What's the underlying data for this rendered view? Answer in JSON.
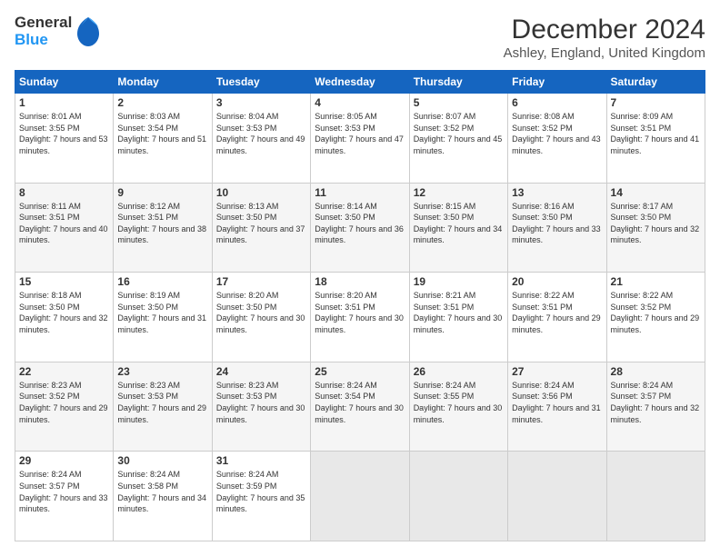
{
  "logo": {
    "line1": "General",
    "line2": "Blue"
  },
  "title": "December 2024",
  "subtitle": "Ashley, England, United Kingdom",
  "headers": [
    "Sunday",
    "Monday",
    "Tuesday",
    "Wednesday",
    "Thursday",
    "Friday",
    "Saturday"
  ],
  "weeks": [
    [
      {
        "day": "1",
        "sunrise": "Sunrise: 8:01 AM",
        "sunset": "Sunset: 3:55 PM",
        "daylight": "Daylight: 7 hours and 53 minutes."
      },
      {
        "day": "2",
        "sunrise": "Sunrise: 8:03 AM",
        "sunset": "Sunset: 3:54 PM",
        "daylight": "Daylight: 7 hours and 51 minutes."
      },
      {
        "day": "3",
        "sunrise": "Sunrise: 8:04 AM",
        "sunset": "Sunset: 3:53 PM",
        "daylight": "Daylight: 7 hours and 49 minutes."
      },
      {
        "day": "4",
        "sunrise": "Sunrise: 8:05 AM",
        "sunset": "Sunset: 3:53 PM",
        "daylight": "Daylight: 7 hours and 47 minutes."
      },
      {
        "day": "5",
        "sunrise": "Sunrise: 8:07 AM",
        "sunset": "Sunset: 3:52 PM",
        "daylight": "Daylight: 7 hours and 45 minutes."
      },
      {
        "day": "6",
        "sunrise": "Sunrise: 8:08 AM",
        "sunset": "Sunset: 3:52 PM",
        "daylight": "Daylight: 7 hours and 43 minutes."
      },
      {
        "day": "7",
        "sunrise": "Sunrise: 8:09 AM",
        "sunset": "Sunset: 3:51 PM",
        "daylight": "Daylight: 7 hours and 41 minutes."
      }
    ],
    [
      {
        "day": "8",
        "sunrise": "Sunrise: 8:11 AM",
        "sunset": "Sunset: 3:51 PM",
        "daylight": "Daylight: 7 hours and 40 minutes."
      },
      {
        "day": "9",
        "sunrise": "Sunrise: 8:12 AM",
        "sunset": "Sunset: 3:51 PM",
        "daylight": "Daylight: 7 hours and 38 minutes."
      },
      {
        "day": "10",
        "sunrise": "Sunrise: 8:13 AM",
        "sunset": "Sunset: 3:50 PM",
        "daylight": "Daylight: 7 hours and 37 minutes."
      },
      {
        "day": "11",
        "sunrise": "Sunrise: 8:14 AM",
        "sunset": "Sunset: 3:50 PM",
        "daylight": "Daylight: 7 hours and 36 minutes."
      },
      {
        "day": "12",
        "sunrise": "Sunrise: 8:15 AM",
        "sunset": "Sunset: 3:50 PM",
        "daylight": "Daylight: 7 hours and 34 minutes."
      },
      {
        "day": "13",
        "sunrise": "Sunrise: 8:16 AM",
        "sunset": "Sunset: 3:50 PM",
        "daylight": "Daylight: 7 hours and 33 minutes."
      },
      {
        "day": "14",
        "sunrise": "Sunrise: 8:17 AM",
        "sunset": "Sunset: 3:50 PM",
        "daylight": "Daylight: 7 hours and 32 minutes."
      }
    ],
    [
      {
        "day": "15",
        "sunrise": "Sunrise: 8:18 AM",
        "sunset": "Sunset: 3:50 PM",
        "daylight": "Daylight: 7 hours and 32 minutes."
      },
      {
        "day": "16",
        "sunrise": "Sunrise: 8:19 AM",
        "sunset": "Sunset: 3:50 PM",
        "daylight": "Daylight: 7 hours and 31 minutes."
      },
      {
        "day": "17",
        "sunrise": "Sunrise: 8:20 AM",
        "sunset": "Sunset: 3:50 PM",
        "daylight": "Daylight: 7 hours and 30 minutes."
      },
      {
        "day": "18",
        "sunrise": "Sunrise: 8:20 AM",
        "sunset": "Sunset: 3:51 PM",
        "daylight": "Daylight: 7 hours and 30 minutes."
      },
      {
        "day": "19",
        "sunrise": "Sunrise: 8:21 AM",
        "sunset": "Sunset: 3:51 PM",
        "daylight": "Daylight: 7 hours and 30 minutes."
      },
      {
        "day": "20",
        "sunrise": "Sunrise: 8:22 AM",
        "sunset": "Sunset: 3:51 PM",
        "daylight": "Daylight: 7 hours and 29 minutes."
      },
      {
        "day": "21",
        "sunrise": "Sunrise: 8:22 AM",
        "sunset": "Sunset: 3:52 PM",
        "daylight": "Daylight: 7 hours and 29 minutes."
      }
    ],
    [
      {
        "day": "22",
        "sunrise": "Sunrise: 8:23 AM",
        "sunset": "Sunset: 3:52 PM",
        "daylight": "Daylight: 7 hours and 29 minutes."
      },
      {
        "day": "23",
        "sunrise": "Sunrise: 8:23 AM",
        "sunset": "Sunset: 3:53 PM",
        "daylight": "Daylight: 7 hours and 29 minutes."
      },
      {
        "day": "24",
        "sunrise": "Sunrise: 8:23 AM",
        "sunset": "Sunset: 3:53 PM",
        "daylight": "Daylight: 7 hours and 30 minutes."
      },
      {
        "day": "25",
        "sunrise": "Sunrise: 8:24 AM",
        "sunset": "Sunset: 3:54 PM",
        "daylight": "Daylight: 7 hours and 30 minutes."
      },
      {
        "day": "26",
        "sunrise": "Sunrise: 8:24 AM",
        "sunset": "Sunset: 3:55 PM",
        "daylight": "Daylight: 7 hours and 30 minutes."
      },
      {
        "day": "27",
        "sunrise": "Sunrise: 8:24 AM",
        "sunset": "Sunset: 3:56 PM",
        "daylight": "Daylight: 7 hours and 31 minutes."
      },
      {
        "day": "28",
        "sunrise": "Sunrise: 8:24 AM",
        "sunset": "Sunset: 3:57 PM",
        "daylight": "Daylight: 7 hours and 32 minutes."
      }
    ],
    [
      {
        "day": "29",
        "sunrise": "Sunrise: 8:24 AM",
        "sunset": "Sunset: 3:57 PM",
        "daylight": "Daylight: 7 hours and 33 minutes."
      },
      {
        "day": "30",
        "sunrise": "Sunrise: 8:24 AM",
        "sunset": "Sunset: 3:58 PM",
        "daylight": "Daylight: 7 hours and 34 minutes."
      },
      {
        "day": "31",
        "sunrise": "Sunrise: 8:24 AM",
        "sunset": "Sunset: 3:59 PM",
        "daylight": "Daylight: 7 hours and 35 minutes."
      },
      null,
      null,
      null,
      null
    ]
  ]
}
